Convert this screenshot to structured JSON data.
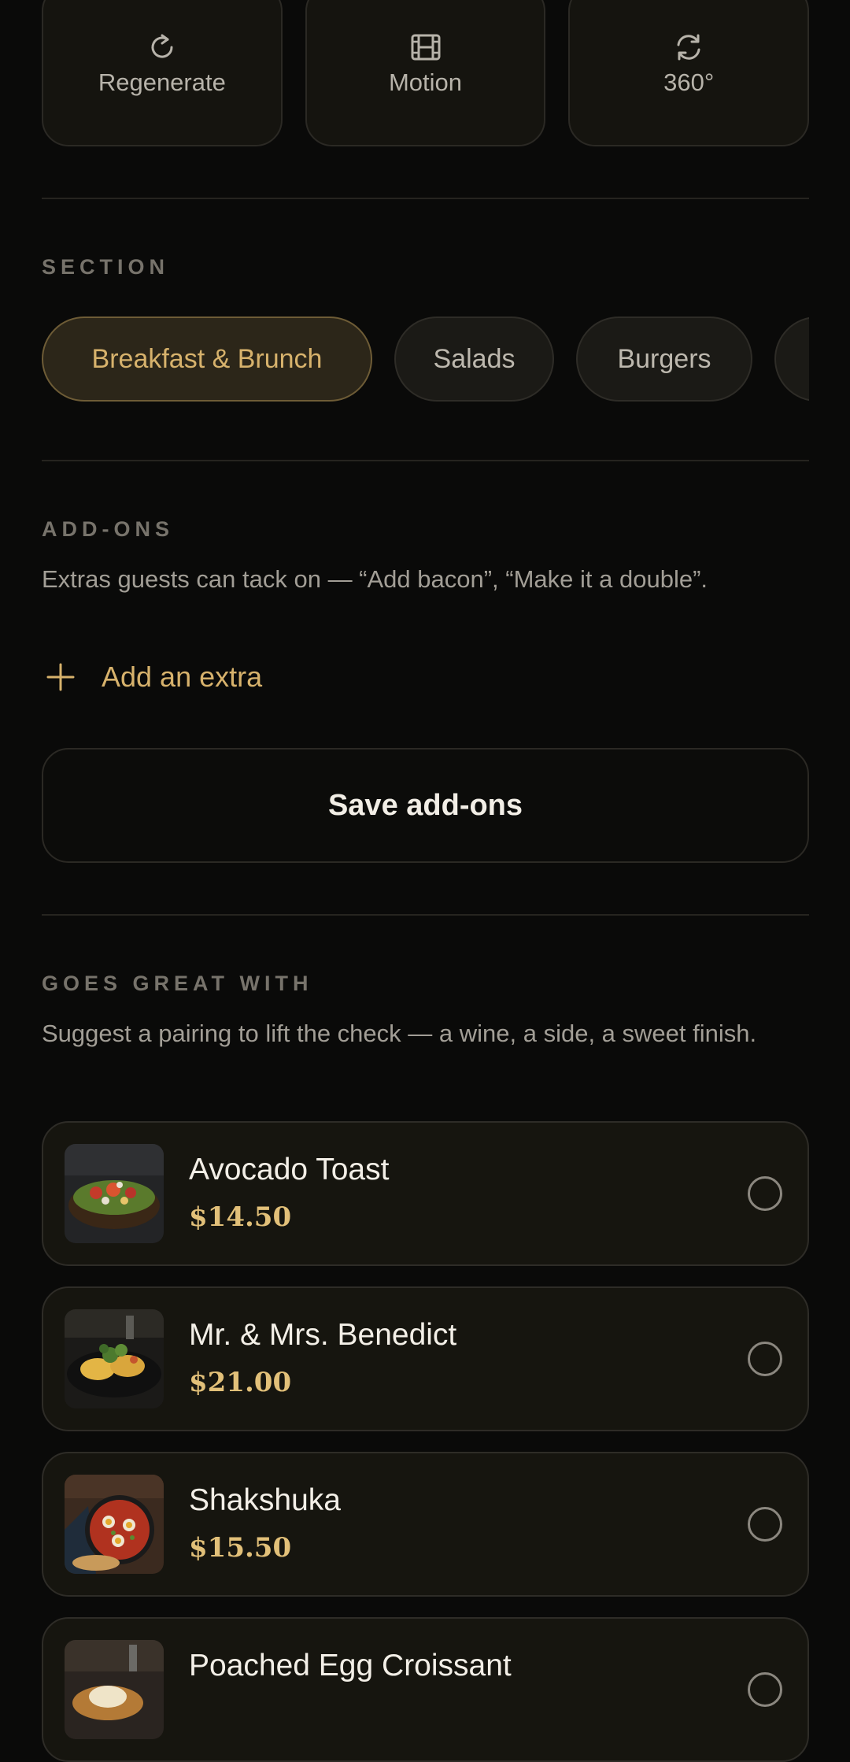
{
  "actions": [
    {
      "label": "Regenerate",
      "icon": "refresh-icon"
    },
    {
      "label": "Motion",
      "icon": "film-icon"
    },
    {
      "label": "360°",
      "icon": "rotate-360-icon"
    }
  ],
  "section": {
    "heading": "SECTION",
    "chips": [
      {
        "label": "Breakfast & Brunch",
        "selected": true
      },
      {
        "label": "Salads",
        "selected": false
      },
      {
        "label": "Burgers",
        "selected": false
      },
      {
        "label": "",
        "selected": false
      }
    ]
  },
  "addons": {
    "heading": "ADD-ONS",
    "description": "Extras guests can tack on — “Add bacon”, “Make it a double”.",
    "add_label": "Add an extra",
    "save_label": "Save add-ons"
  },
  "pairing": {
    "heading": "GOES GREAT WITH",
    "description": "Suggest a pairing to lift the check — a wine, a side, a sweet finish.",
    "items": [
      {
        "name": "Avocado Toast",
        "price": "$14.50",
        "selected": false
      },
      {
        "name": "Mr. & Mrs. Benedict",
        "price": "$21.00",
        "selected": false
      },
      {
        "name": "Shakshuka",
        "price": "$15.50",
        "selected": false
      },
      {
        "name": "Poached Egg Croissant",
        "price": "",
        "selected": false
      }
    ]
  },
  "colors": {
    "accent": "#d7b26c",
    "price": "#e2c079",
    "background": "#0a0a09"
  }
}
